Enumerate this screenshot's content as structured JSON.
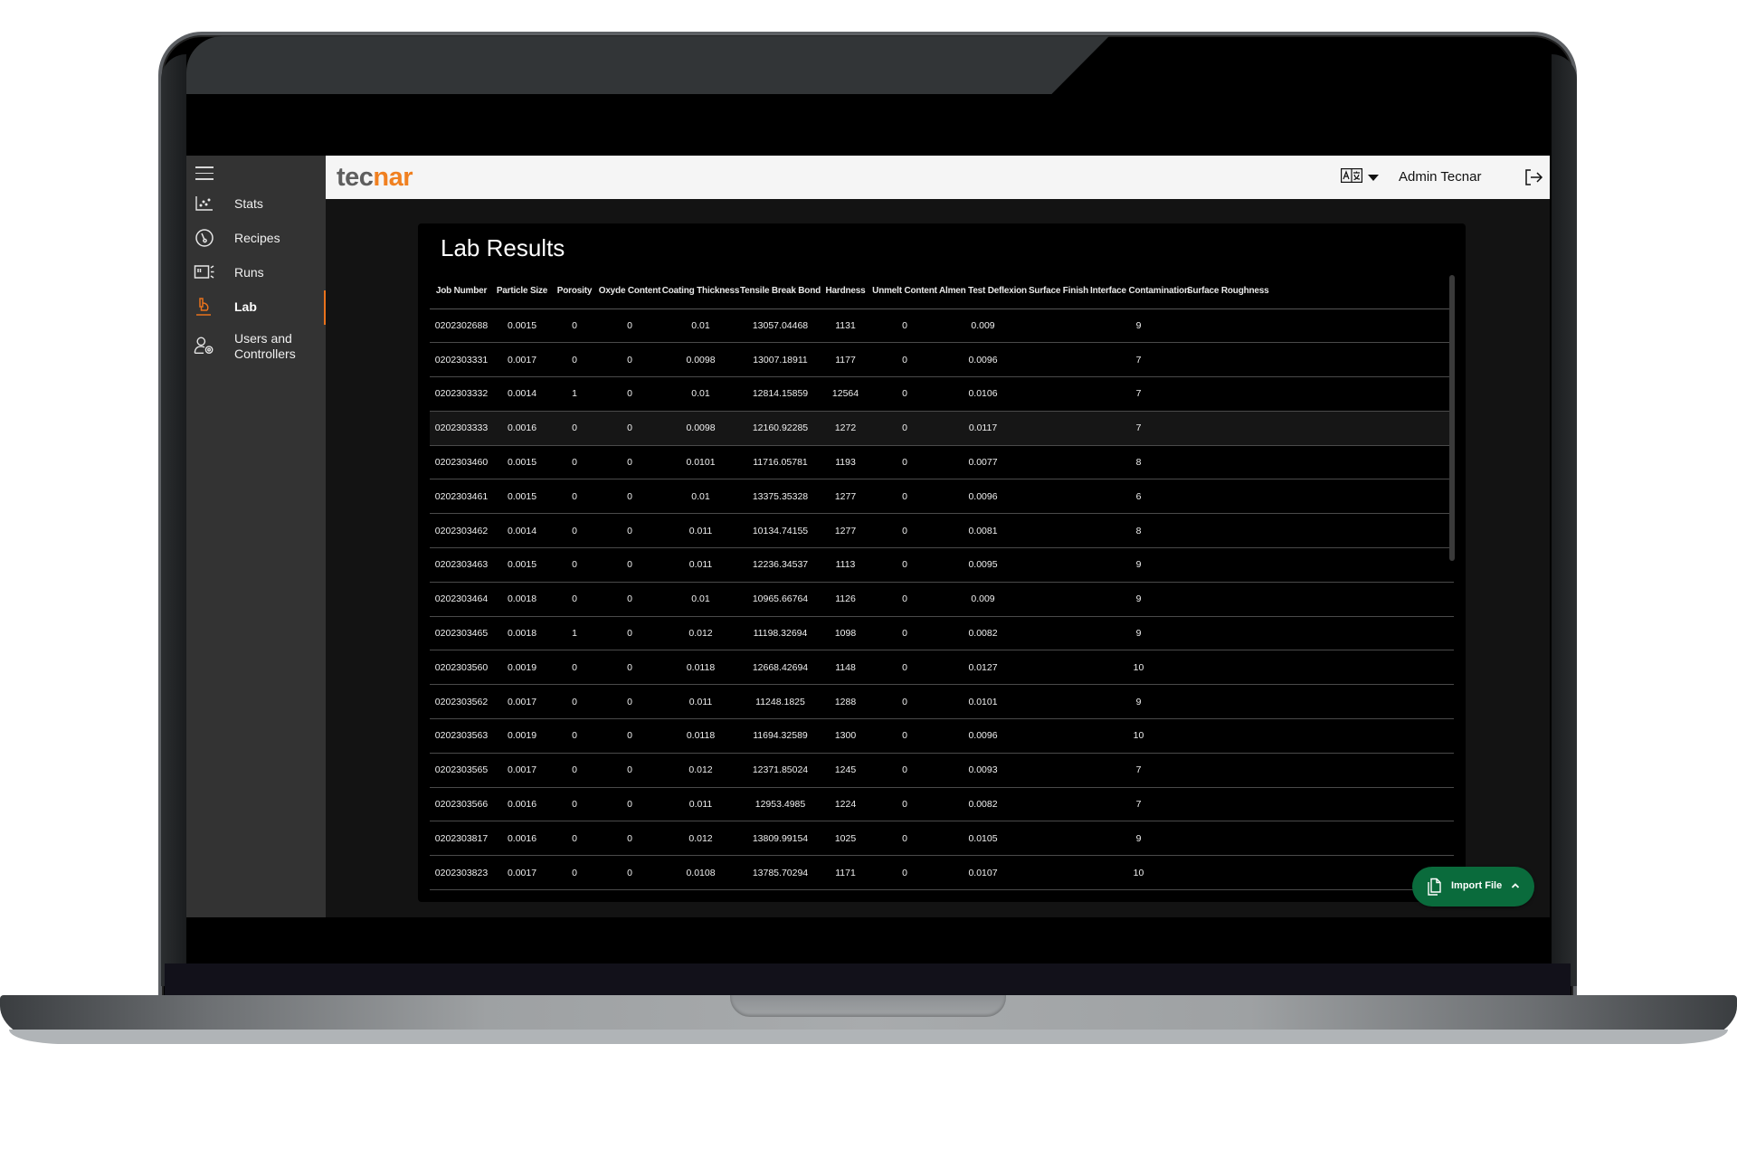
{
  "app": {
    "brand": {
      "logo_part1": "tec",
      "logo_part2": "nar",
      "primary_color": "#f08020",
      "secondary_color": "#5e5e5e"
    },
    "accent_color": "#e8721c",
    "import_color": "#0a6b3c"
  },
  "sidebar": {
    "menu_icon": "hamburger-icon",
    "items": [
      {
        "label": "Stats",
        "icon": "scatter-chart-icon",
        "active": false
      },
      {
        "label": "Recipes",
        "icon": "gauge-icon",
        "active": false
      },
      {
        "label": "Runs",
        "icon": "runs-icon",
        "active": false
      },
      {
        "label": "Lab",
        "icon": "microscope-icon",
        "active": true
      },
      {
        "label": "Users and",
        "label2": "Controllers",
        "icon": "user-settings-icon",
        "active": false
      }
    ]
  },
  "header": {
    "language_icon": "translate-icon",
    "user_name": "Admin Tecnar",
    "logout_icon": "logout-icon"
  },
  "main": {
    "title": "Lab Results",
    "table": {
      "columns": [
        "Job Number",
        "Particle Size",
        "Porosity",
        "Oxyde Content",
        "Coating Thickness",
        "Tensile Break Bond",
        "Hardness",
        "Unmelt Content",
        "Almen Test Deflexion",
        "Surface Finish",
        "Interface Contamination",
        "Surface Roughness"
      ],
      "hovered_row": 3,
      "rows": [
        [
          "0202302688",
          "0.0015",
          "0",
          "0",
          "0.01",
          "13057.04468",
          "1131",
          "0",
          "0.009",
          "",
          "9",
          ""
        ],
        [
          "0202303331",
          "0.0017",
          "0",
          "0",
          "0.0098",
          "13007.18911",
          "1177",
          "0",
          "0.0096",
          "",
          "7",
          ""
        ],
        [
          "0202303332",
          "0.0014",
          "1",
          "0",
          "0.01",
          "12814.15859",
          "12564",
          "0",
          "0.0106",
          "",
          "7",
          ""
        ],
        [
          "0202303333",
          "0.0016",
          "0",
          "0",
          "0.0098",
          "12160.92285",
          "1272",
          "0",
          "0.0117",
          "",
          "7",
          ""
        ],
        [
          "0202303460",
          "0.0015",
          "0",
          "0",
          "0.0101",
          "11716.05781",
          "1193",
          "0",
          "0.0077",
          "",
          "8",
          ""
        ],
        [
          "0202303461",
          "0.0015",
          "0",
          "0",
          "0.01",
          "13375.35328",
          "1277",
          "0",
          "0.0096",
          "",
          "6",
          ""
        ],
        [
          "0202303462",
          "0.0014",
          "0",
          "0",
          "0.011",
          "10134.74155",
          "1277",
          "0",
          "0.0081",
          "",
          "8",
          ""
        ],
        [
          "0202303463",
          "0.0015",
          "0",
          "0",
          "0.011",
          "12236.34537",
          "1113",
          "0",
          "0.0095",
          "",
          "9",
          ""
        ],
        [
          "0202303464",
          "0.0018",
          "0",
          "0",
          "0.01",
          "10965.66764",
          "1126",
          "0",
          "0.009",
          "",
          "9",
          ""
        ],
        [
          "0202303465",
          "0.0018",
          "1",
          "0",
          "0.012",
          "11198.32694",
          "1098",
          "0",
          "0.0082",
          "",
          "9",
          ""
        ],
        [
          "0202303560",
          "0.0019",
          "0",
          "0",
          "0.0118",
          "12668.42694",
          "1148",
          "0",
          "0.0127",
          "",
          "10",
          ""
        ],
        [
          "0202303562",
          "0.0017",
          "0",
          "0",
          "0.011",
          "11248.1825",
          "1288",
          "0",
          "0.0101",
          "",
          "9",
          ""
        ],
        [
          "0202303563",
          "0.0019",
          "0",
          "0",
          "0.0118",
          "11694.32589",
          "1300",
          "0",
          "0.0096",
          "",
          "10",
          ""
        ],
        [
          "0202303565",
          "0.0017",
          "0",
          "0",
          "0.012",
          "12371.85024",
          "1245",
          "0",
          "0.0093",
          "",
          "7",
          ""
        ],
        [
          "0202303566",
          "0.0016",
          "0",
          "0",
          "0.011",
          "12953.4985",
          "1224",
          "0",
          "0.0082",
          "",
          "7",
          ""
        ],
        [
          "0202303817",
          "0.0016",
          "0",
          "0",
          "0.012",
          "13809.99154",
          "1025",
          "0",
          "0.0105",
          "",
          "9",
          ""
        ],
        [
          "0202303823",
          "0.0017",
          "0",
          "0",
          "0.0108",
          "13785.70294",
          "1171",
          "0",
          "0.0107",
          "",
          "10",
          ""
        ]
      ]
    },
    "import_button": {
      "label": "Import File",
      "icon": "file-copy-icon",
      "chevron_icon": "chevron-up-icon"
    }
  }
}
